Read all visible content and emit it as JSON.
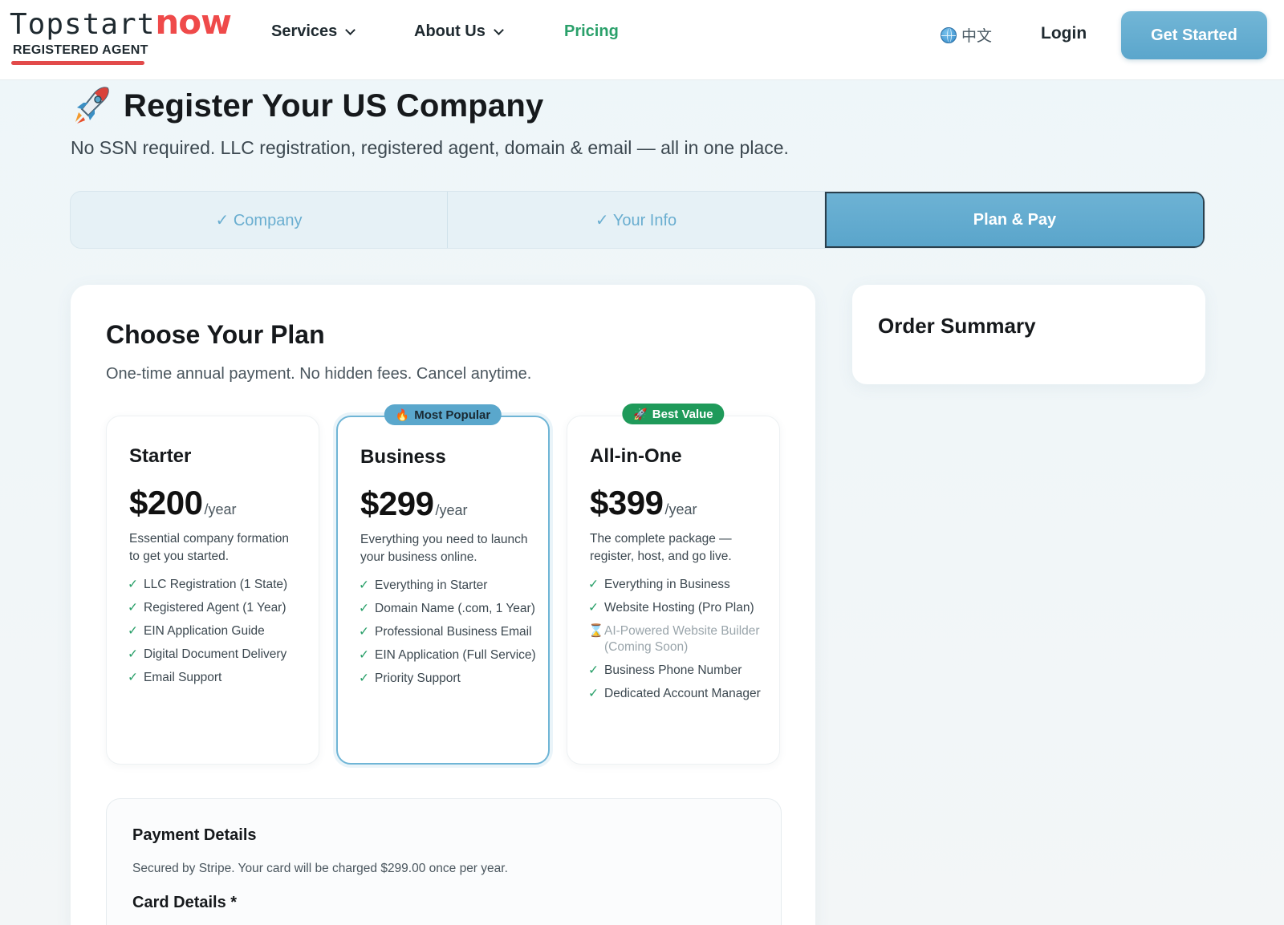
{
  "header": {
    "logo_main": "Topstart",
    "logo_accent": "now",
    "logo_sub": "REGISTERED AGENT",
    "nav": [
      {
        "label": "Services",
        "has_dropdown": true
      },
      {
        "label": "About Us",
        "has_dropdown": true
      },
      {
        "label": "Pricing",
        "has_dropdown": false
      }
    ],
    "language": "中文",
    "login": "Login",
    "cta": "Get Started"
  },
  "page": {
    "title": "Register Your US Company",
    "subtitle": "No SSN required. LLC registration, registered agent, domain & email — all in one place."
  },
  "steps": [
    {
      "label": "✓ Company",
      "state": "done"
    },
    {
      "label": "✓ Your Info",
      "state": "done"
    },
    {
      "label": "Plan & Pay",
      "state": "active"
    }
  ],
  "plans_section": {
    "title": "Choose Your Plan",
    "subtitle": "One-time annual payment. No hidden fees. Cancel anytime."
  },
  "plans": [
    {
      "name": "Starter",
      "price": "$200",
      "period": "/year",
      "description": "Essential company formation to get you started.",
      "features": [
        "LLC Registration (1 State)",
        "Registered Agent (1 Year)",
        "EIN Application Guide",
        "Digital Document Delivery",
        "Email Support"
      ]
    },
    {
      "name": "Business",
      "badge": "Most Popular",
      "badge_icon": "🔥",
      "price": "$299",
      "period": "/year",
      "description": "Everything you need to launch your business online.",
      "features": [
        "Everything in Starter",
        "Domain Name (.com, 1 Year)",
        "Professional Business Email",
        "EIN Application (Full Service)",
        "Priority Support"
      ]
    },
    {
      "name": "All-in-One",
      "badge": "Best Value",
      "badge_icon": "🚀",
      "price": "$399",
      "period": "/year",
      "description": "The complete package — register, host, and go live.",
      "features": [
        "Everything in Business",
        "Website Hosting (Pro Plan)",
        "AI-Powered Website Builder (Coming Soon)",
        "Business Phone Number",
        "Dedicated Account Manager"
      ]
    }
  ],
  "payment": {
    "title": "Payment Details",
    "subtitle": "Secured by Stripe. Your card will be charged $299.00 once per year.",
    "card_label": "Card Details *"
  },
  "summary": {
    "title": "Order Summary"
  },
  "icons": {
    "check": "✓",
    "hourglass": "⌛",
    "rocket": "rocket-icon",
    "globe": "globe-icon"
  },
  "colors": {
    "accent": "#5aa7cc",
    "pricing_link": "#2aa06a",
    "logo_accent": "#ef4a4a",
    "best_value": "#1f9a5a"
  }
}
